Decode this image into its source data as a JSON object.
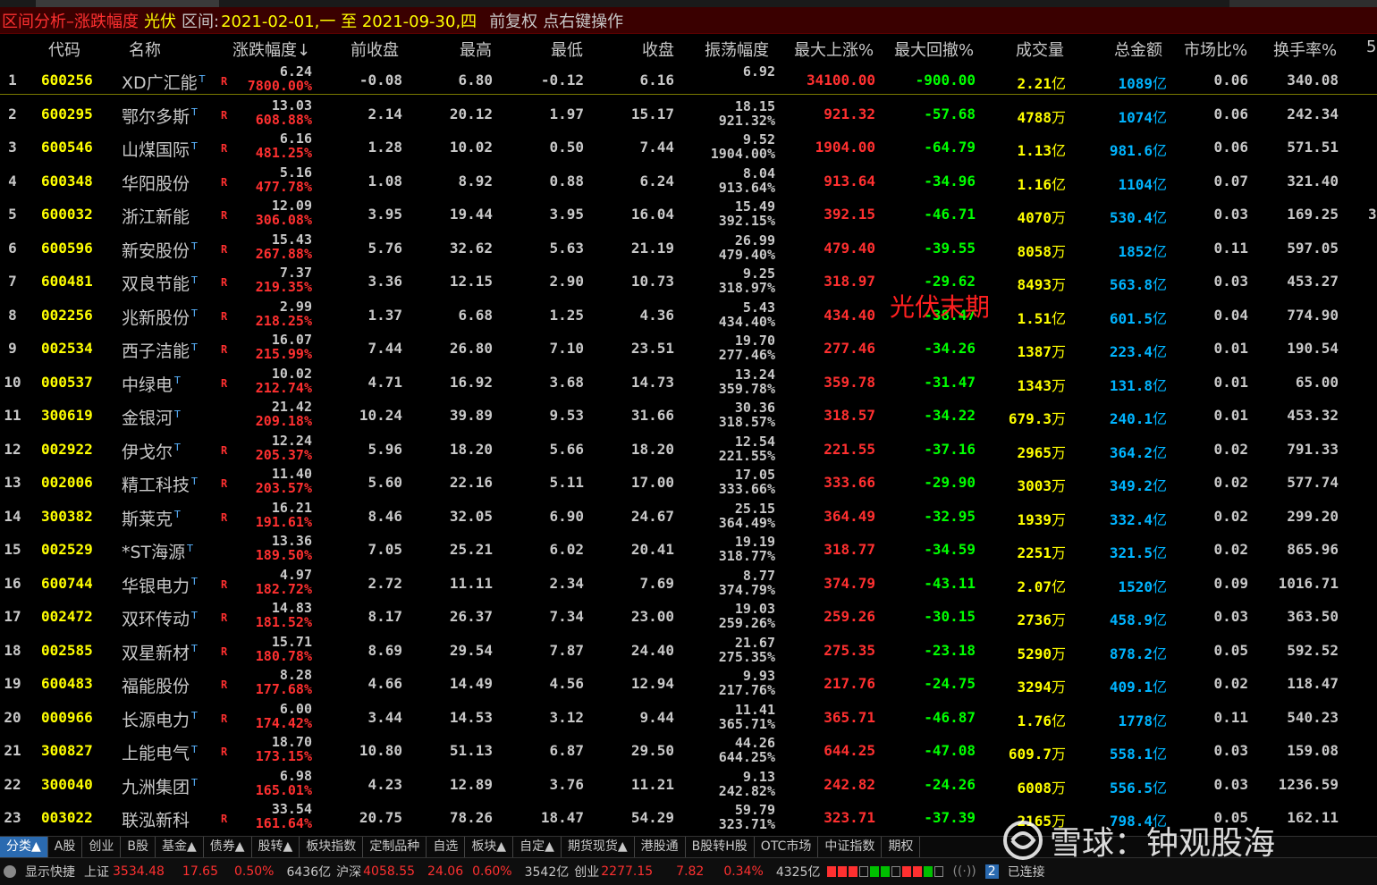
{
  "titlebar": {
    "title": "区间分析–涨跌幅度",
    "sector": "光伏",
    "range_label": "区间:",
    "range": "2021-02-01,一 至 2021-09-30,四",
    "adjust": "前复权",
    "hint": "点右键操作"
  },
  "columns": [
    "代码",
    "名称",
    "涨跌幅度↓",
    "前收盘",
    "最高",
    "最低",
    "收盘",
    "振荡幅度",
    "最大上涨%",
    "最大回撤%",
    "成交量",
    "总金额",
    "市场比%",
    "换手率%",
    "5"
  ],
  "annotation": "光伏末期",
  "rows": [
    {
      "idx": "1",
      "code": "600256",
      "name": "XD广汇能",
      "t": "T",
      "r": "R",
      "price": "6.24",
      "pct": "7800.00%",
      "prev": "-0.08",
      "high": "6.80",
      "low": "-0.12",
      "close": "6.16",
      "amp1": "6.92",
      "amp2": "",
      "maxup": "34100.00",
      "maxdd": "-900.00",
      "vol": "2.21",
      "vol_u": "亿",
      "amt": "1089",
      "amt_u": "亿",
      "mkt": "0.06",
      "turn": "340.08",
      "extra": ""
    },
    {
      "idx": "2",
      "code": "600295",
      "name": "鄂尔多斯",
      "t": "T",
      "r": "R",
      "price": "13.03",
      "pct": "608.88%",
      "prev": "2.14",
      "high": "20.12",
      "low": "1.97",
      "close": "15.17",
      "amp1": "18.15",
      "amp2": "921.32%",
      "maxup": "921.32",
      "maxdd": "-57.68",
      "vol": "4788",
      "vol_u": "万",
      "amt": "1074",
      "amt_u": "亿",
      "mkt": "0.06",
      "turn": "242.34",
      "extra": ""
    },
    {
      "idx": "3",
      "code": "600546",
      "name": "山煤国际",
      "t": "T",
      "r": "R",
      "price": "6.16",
      "pct": "481.25%",
      "prev": "1.28",
      "high": "10.02",
      "low": "0.50",
      "close": "7.44",
      "amp1": "9.52",
      "amp2": "1904.00%",
      "maxup": "1904.00",
      "maxdd": "-64.79",
      "vol": "1.13",
      "vol_u": "亿",
      "amt": "981.6",
      "amt_u": "亿",
      "mkt": "0.06",
      "turn": "571.51",
      "extra": ""
    },
    {
      "idx": "4",
      "code": "600348",
      "name": "华阳股份",
      "t": "",
      "r": "R",
      "price": "5.16",
      "pct": "477.78%",
      "prev": "1.08",
      "high": "8.92",
      "low": "0.88",
      "close": "6.24",
      "amp1": "8.04",
      "amp2": "913.64%",
      "maxup": "913.64",
      "maxdd": "-34.96",
      "vol": "1.16",
      "vol_u": "亿",
      "amt": "1104",
      "amt_u": "亿",
      "mkt": "0.07",
      "turn": "321.40",
      "extra": ""
    },
    {
      "idx": "5",
      "code": "600032",
      "name": "浙江新能",
      "t": "",
      "r": "R",
      "price": "12.09",
      "pct": "306.08%",
      "prev": "3.95",
      "high": "19.44",
      "low": "3.95",
      "close": "16.04",
      "amp1": "15.49",
      "amp2": "392.15%",
      "maxup": "392.15",
      "maxdd": "-46.71",
      "vol": "4070",
      "vol_u": "万",
      "amt": "530.4",
      "amt_u": "亿",
      "mkt": "0.03",
      "turn": "169.25",
      "extra": "3"
    },
    {
      "idx": "6",
      "code": "600596",
      "name": "新安股份",
      "t": "T",
      "r": "R",
      "price": "15.43",
      "pct": "267.88%",
      "prev": "5.76",
      "high": "32.62",
      "low": "5.63",
      "close": "21.19",
      "amp1": "26.99",
      "amp2": "479.40%",
      "maxup": "479.40",
      "maxdd": "-39.55",
      "vol": "8058",
      "vol_u": "万",
      "amt": "1852",
      "amt_u": "亿",
      "mkt": "0.11",
      "turn": "597.05",
      "extra": ""
    },
    {
      "idx": "7",
      "code": "600481",
      "name": "双良节能",
      "t": "T",
      "r": "R",
      "price": "7.37",
      "pct": "219.35%",
      "prev": "3.36",
      "high": "12.15",
      "low": "2.90",
      "close": "10.73",
      "amp1": "9.25",
      "amp2": "318.97%",
      "maxup": "318.97",
      "maxdd": "-29.62",
      "vol": "8493",
      "vol_u": "万",
      "amt": "563.8",
      "amt_u": "亿",
      "mkt": "0.03",
      "turn": "453.27",
      "extra": ""
    },
    {
      "idx": "8",
      "code": "002256",
      "name": "兆新股份",
      "t": "T",
      "r": "R",
      "price": "2.99",
      "pct": "218.25%",
      "prev": "1.37",
      "high": "6.68",
      "low": "1.25",
      "close": "4.36",
      "amp1": "5.43",
      "amp2": "434.40%",
      "maxup": "434.40",
      "maxdd": "-38.47",
      "vol": "1.51",
      "vol_u": "亿",
      "amt": "601.5",
      "amt_u": "亿",
      "mkt": "0.04",
      "turn": "774.90",
      "extra": ""
    },
    {
      "idx": "9",
      "code": "002534",
      "name": "西子洁能",
      "t": "T",
      "r": "R",
      "price": "16.07",
      "pct": "215.99%",
      "prev": "7.44",
      "high": "26.80",
      "low": "7.10",
      "close": "23.51",
      "amp1": "19.70",
      "amp2": "277.46%",
      "maxup": "277.46",
      "maxdd": "-34.26",
      "vol": "1387",
      "vol_u": "万",
      "amt": "223.4",
      "amt_u": "亿",
      "mkt": "0.01",
      "turn": "190.54",
      "extra": ""
    },
    {
      "idx": "10",
      "code": "000537",
      "name": "中绿电",
      "t": "T",
      "r": "R",
      "price": "10.02",
      "pct": "212.74%",
      "prev": "4.71",
      "high": "16.92",
      "low": "3.68",
      "close": "14.73",
      "amp1": "13.24",
      "amp2": "359.78%",
      "maxup": "359.78",
      "maxdd": "-31.47",
      "vol": "1343",
      "vol_u": "万",
      "amt": "131.8",
      "amt_u": "亿",
      "mkt": "0.01",
      "turn": "65.00",
      "extra": ""
    },
    {
      "idx": "11",
      "code": "300619",
      "name": "金银河",
      "t": "T",
      "r": "",
      "price": "21.42",
      "pct": "209.18%",
      "prev": "10.24",
      "high": "39.89",
      "low": "9.53",
      "close": "31.66",
      "amp1": "30.36",
      "amp2": "318.57%",
      "maxup": "318.57",
      "maxdd": "-34.22",
      "vol": "679.3",
      "vol_u": "万",
      "amt": "240.1",
      "amt_u": "亿",
      "mkt": "0.01",
      "turn": "453.32",
      "extra": ""
    },
    {
      "idx": "12",
      "code": "002922",
      "name": "伊戈尔",
      "t": "T",
      "r": "R",
      "price": "12.24",
      "pct": "205.37%",
      "prev": "5.96",
      "high": "18.20",
      "low": "5.66",
      "close": "18.20",
      "amp1": "12.54",
      "amp2": "221.55%",
      "maxup": "221.55",
      "maxdd": "-37.16",
      "vol": "2965",
      "vol_u": "万",
      "amt": "364.2",
      "amt_u": "亿",
      "mkt": "0.02",
      "turn": "791.33",
      "extra": ""
    },
    {
      "idx": "13",
      "code": "002006",
      "name": "精工科技",
      "t": "T",
      "r": "R",
      "price": "11.40",
      "pct": "203.57%",
      "prev": "5.60",
      "high": "22.16",
      "low": "5.11",
      "close": "17.00",
      "amp1": "17.05",
      "amp2": "333.66%",
      "maxup": "333.66",
      "maxdd": "-29.90",
      "vol": "3003",
      "vol_u": "万",
      "amt": "349.2",
      "amt_u": "亿",
      "mkt": "0.02",
      "turn": "577.74",
      "extra": ""
    },
    {
      "idx": "14",
      "code": "300382",
      "name": "斯莱克",
      "t": "T",
      "r": "R",
      "price": "16.21",
      "pct": "191.61%",
      "prev": "8.46",
      "high": "32.05",
      "low": "6.90",
      "close": "24.67",
      "amp1": "25.15",
      "amp2": "364.49%",
      "maxup": "364.49",
      "maxdd": "-32.95",
      "vol": "1939",
      "vol_u": "万",
      "amt": "332.4",
      "amt_u": "亿",
      "mkt": "0.02",
      "turn": "299.20",
      "extra": ""
    },
    {
      "idx": "15",
      "code": "002529",
      "name": "*ST海源",
      "t": "T",
      "r": "",
      "price": "13.36",
      "pct": "189.50%",
      "prev": "7.05",
      "high": "25.21",
      "low": "6.02",
      "close": "20.41",
      "amp1": "19.19",
      "amp2": "318.77%",
      "maxup": "318.77",
      "maxdd": "-34.59",
      "vol": "2251",
      "vol_u": "万",
      "amt": "321.5",
      "amt_u": "亿",
      "mkt": "0.02",
      "turn": "865.96",
      "extra": ""
    },
    {
      "idx": "16",
      "code": "600744",
      "name": "华银电力",
      "t": "T",
      "r": "R",
      "price": "4.97",
      "pct": "182.72%",
      "prev": "2.72",
      "high": "11.11",
      "low": "2.34",
      "close": "7.69",
      "amp1": "8.77",
      "amp2": "374.79%",
      "maxup": "374.79",
      "maxdd": "-43.11",
      "vol": "2.07",
      "vol_u": "亿",
      "amt": "1520",
      "amt_u": "亿",
      "mkt": "0.09",
      "turn": "1016.71",
      "extra": ""
    },
    {
      "idx": "17",
      "code": "002472",
      "name": "双环传动",
      "t": "T",
      "r": "R",
      "price": "14.83",
      "pct": "181.52%",
      "prev": "8.17",
      "high": "26.37",
      "low": "7.34",
      "close": "23.00",
      "amp1": "19.03",
      "amp2": "259.26%",
      "maxup": "259.26",
      "maxdd": "-30.15",
      "vol": "2736",
      "vol_u": "万",
      "amt": "458.9",
      "amt_u": "亿",
      "mkt": "0.03",
      "turn": "363.50",
      "extra": ""
    },
    {
      "idx": "18",
      "code": "002585",
      "name": "双星新材",
      "t": "T",
      "r": "R",
      "price": "15.71",
      "pct": "180.78%",
      "prev": "8.69",
      "high": "29.54",
      "low": "7.87",
      "close": "24.40",
      "amp1": "21.67",
      "amp2": "275.35%",
      "maxup": "275.35",
      "maxdd": "-23.18",
      "vol": "5290",
      "vol_u": "万",
      "amt": "878.2",
      "amt_u": "亿",
      "mkt": "0.05",
      "turn": "592.52",
      "extra": ""
    },
    {
      "idx": "19",
      "code": "600483",
      "name": "福能股份",
      "t": "",
      "r": "R",
      "price": "8.28",
      "pct": "177.68%",
      "prev": "4.66",
      "high": "14.49",
      "low": "4.56",
      "close": "12.94",
      "amp1": "9.93",
      "amp2": "217.76%",
      "maxup": "217.76",
      "maxdd": "-24.75",
      "vol": "3294",
      "vol_u": "万",
      "amt": "409.1",
      "amt_u": "亿",
      "mkt": "0.02",
      "turn": "118.47",
      "extra": ""
    },
    {
      "idx": "20",
      "code": "000966",
      "name": "长源电力",
      "t": "T",
      "r": "R",
      "price": "6.00",
      "pct": "174.42%",
      "prev": "3.44",
      "high": "14.53",
      "low": "3.12",
      "close": "9.44",
      "amp1": "11.41",
      "amp2": "365.71%",
      "maxup": "365.71",
      "maxdd": "-46.87",
      "vol": "1.76",
      "vol_u": "亿",
      "amt": "1778",
      "amt_u": "亿",
      "mkt": "0.11",
      "turn": "540.23",
      "extra": ""
    },
    {
      "idx": "21",
      "code": "300827",
      "name": "上能电气",
      "t": "T",
      "r": "R",
      "price": "18.70",
      "pct": "173.15%",
      "prev": "10.80",
      "high": "51.13",
      "low": "6.87",
      "close": "29.50",
      "amp1": "44.26",
      "amp2": "644.25%",
      "maxup": "644.25",
      "maxdd": "-47.08",
      "vol": "609.7",
      "vol_u": "万",
      "amt": "558.1",
      "amt_u": "亿",
      "mkt": "0.03",
      "turn": "159.08",
      "extra": ""
    },
    {
      "idx": "22",
      "code": "300040",
      "name": "九洲集团",
      "t": "T",
      "r": "",
      "price": "6.98",
      "pct": "165.01%",
      "prev": "4.23",
      "high": "12.89",
      "low": "3.76",
      "close": "11.21",
      "amp1": "9.13",
      "amp2": "242.82%",
      "maxup": "242.82",
      "maxdd": "-24.26",
      "vol": "6008",
      "vol_u": "万",
      "amt": "556.5",
      "amt_u": "亿",
      "mkt": "0.03",
      "turn": "1236.59",
      "extra": ""
    },
    {
      "idx": "23",
      "code": "003022",
      "name": "联泓新科",
      "t": "",
      "r": "R",
      "price": "33.54",
      "pct": "161.64%",
      "prev": "20.75",
      "high": "78.26",
      "low": "18.47",
      "close": "54.29",
      "amp1": "59.79",
      "amp2": "323.71%",
      "maxup": "323.71",
      "maxdd": "-37.39",
      "vol": "2165",
      "vol_u": "万",
      "amt": "798.4",
      "amt_u": "亿",
      "mkt": "0.05",
      "turn": "162.11",
      "extra": ""
    }
  ],
  "tabs": [
    "分类▲",
    "A股",
    "创业",
    "B股",
    "基金▲",
    "债券▲",
    "股转▲",
    "板块指数",
    "定制品种",
    "自选",
    "板块▲",
    "自定▲",
    "期货现货▲",
    "港股通",
    "B股转H股",
    "OTC市场",
    "中证指数",
    "期权"
  ],
  "status": {
    "shortcut": "显示快捷",
    "sh_label": "上证",
    "sh_val": "3534.48",
    "sh_chg": "17.65",
    "sh_pct": "0.50%",
    "sh_amt": "6436亿",
    "hs_label": "沪深",
    "hs_val": "4058.55",
    "hs_chg": "24.06",
    "hs_pct": "0.60%",
    "hs_amt": "3542亿",
    "cy_label": "创业",
    "cy_val": "2277.15",
    "cy_chg": "7.82",
    "cy_pct": "0.34%",
    "cy_amt": "4325亿",
    "conn_num": "2",
    "conn_text": "已连接"
  },
  "watermark": "雪球：钟观股海",
  "colors": {
    "up": "#ff3030",
    "down": "#00ff00",
    "code": "#ffff00",
    "amount": "#00b4ff",
    "title_bg": "#3a0000"
  }
}
